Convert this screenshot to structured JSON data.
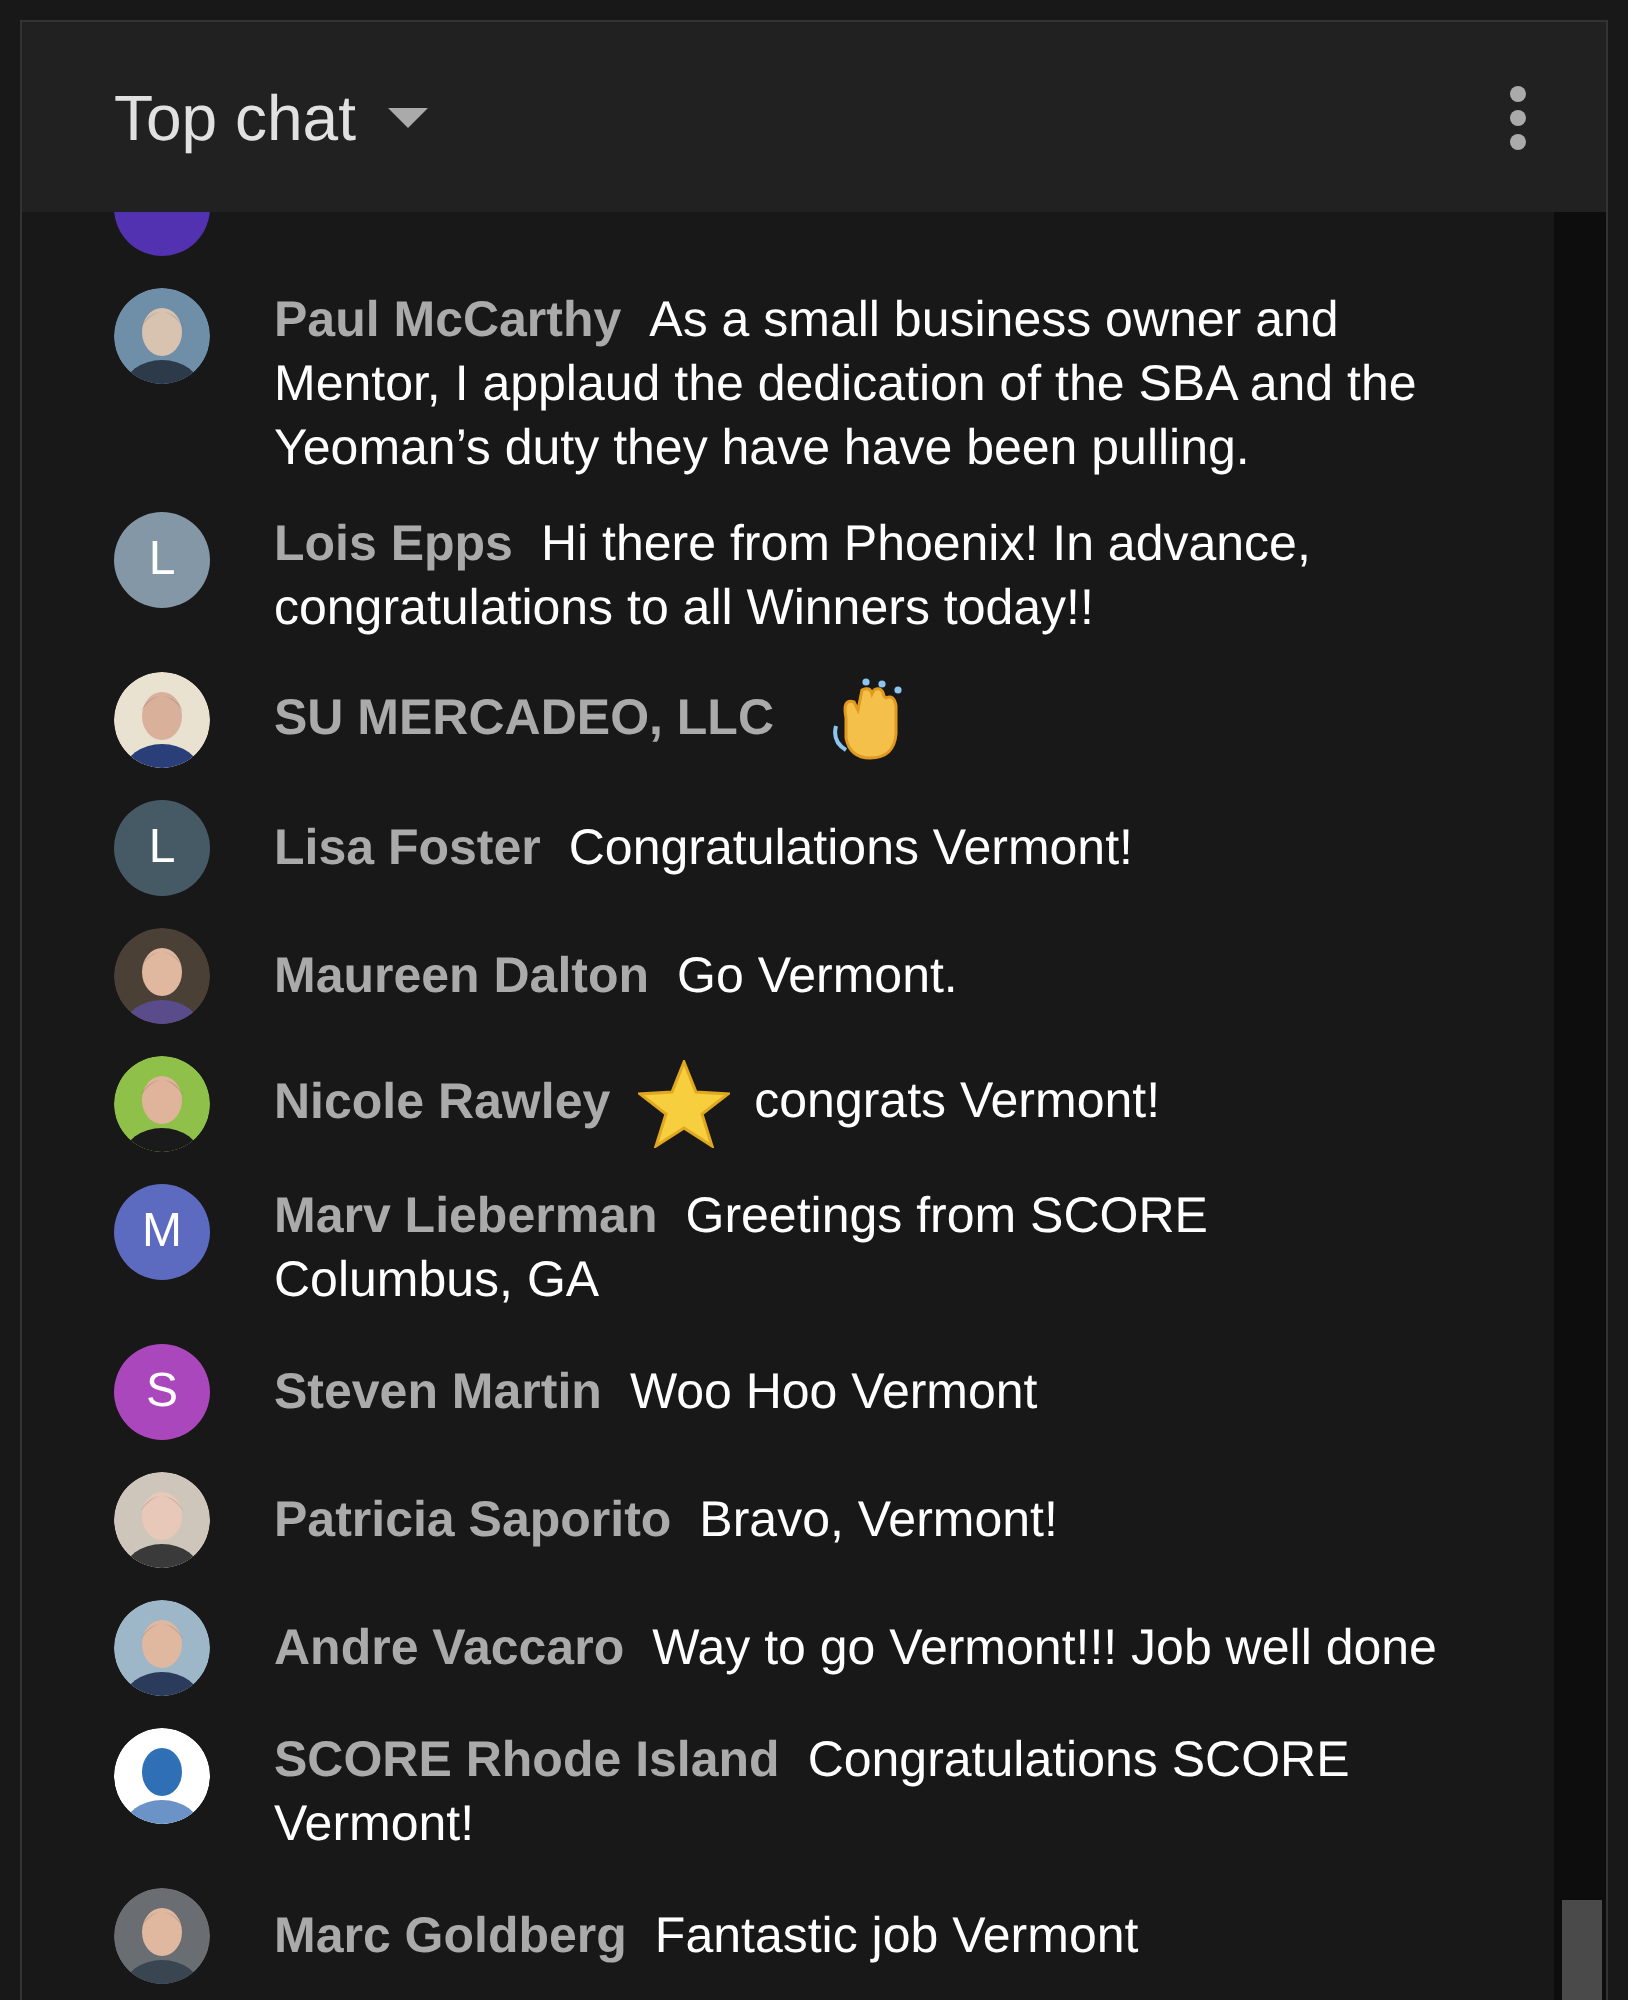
{
  "header": {
    "title": "Top chat"
  },
  "messages": [
    {
      "kind": "text",
      "avatar": {
        "kind": "letter",
        "color": "#5232b0"
      }
    },
    {
      "kind": "text",
      "author": "Paul McCarthy",
      "text": "As a small business owner and Mentor, I applaud the dedication of the SBA and the Yeoman’s duty they have have been pulling."
    },
    {
      "kind": "text",
      "author": "Lois Epps",
      "text": "Hi there from Phoenix! In advance, congratulations to all Winners today!!",
      "avatar": {
        "kind": "letter",
        "letter": "L",
        "color": "#8497a6"
      }
    },
    {
      "kind": "clap",
      "author": "SU MERCADEO, LLC"
    },
    {
      "kind": "text",
      "author": "Lisa Foster",
      "text": "Congratulations Vermont!",
      "avatar": {
        "kind": "letter",
        "letter": "L",
        "color": "#465a65"
      }
    },
    {
      "kind": "text",
      "author": "Maureen Dalton",
      "text": "Go Vermont."
    },
    {
      "kind": "star",
      "author": "Nicole Rawley",
      "text": "congrats Vermont!"
    },
    {
      "kind": "text",
      "author": "Marv Lieberman",
      "text": "Greetings from SCORE Columbus, GA",
      "avatar": {
        "kind": "letter",
        "letter": "M",
        "color": "#5c6bc0"
      }
    },
    {
      "kind": "text",
      "author": "Steven Martin",
      "text": "Woo Hoo Vermont",
      "avatar": {
        "kind": "letter",
        "letter": "S",
        "color": "#ab47bc"
      }
    },
    {
      "kind": "text",
      "author": "Patricia Saporito",
      "text": "Bravo, Vermont!"
    },
    {
      "kind": "text",
      "author": "Andre Vaccaro",
      "text": "Way to go Vermont!!! Job well done"
    },
    {
      "kind": "text",
      "author": "SCORE Rhode Island",
      "text": "Congratulations SCORE Vermont!"
    },
    {
      "kind": "text",
      "author": "Marc Goldberg",
      "text": "Fantastic job Vermont"
    }
  ]
}
